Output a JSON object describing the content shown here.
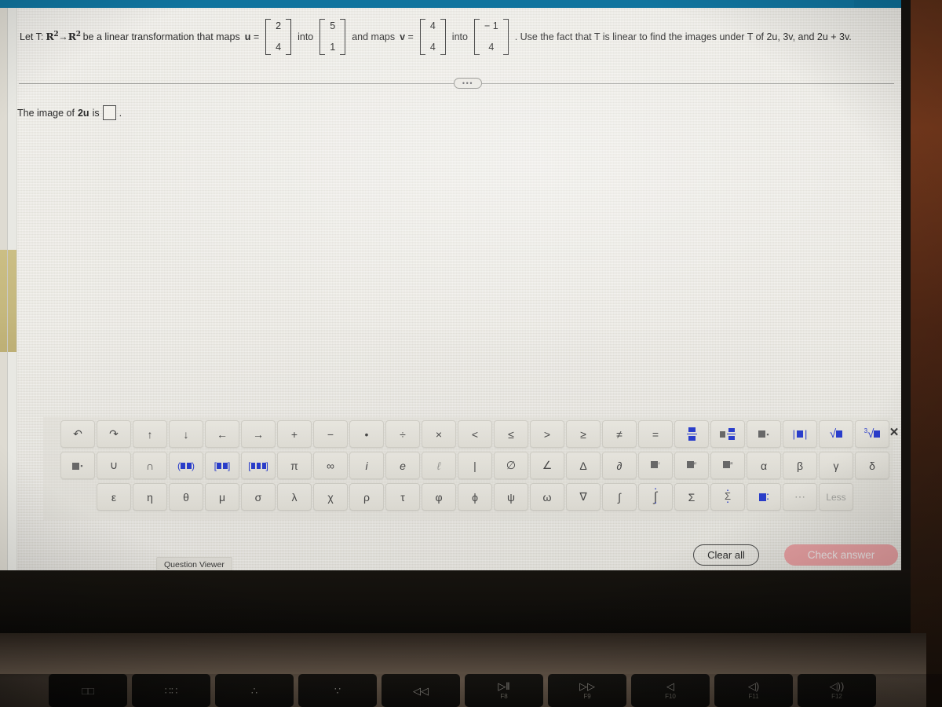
{
  "question": {
    "prefix": "Let T:",
    "domain_space": "R",
    "domain_exp": "2",
    "arrow": "→",
    "codomain_space": "R",
    "codomain_exp": "2",
    "mid1": "be a linear transformation that maps",
    "u_label": "u =",
    "u_vector": [
      "2",
      "4"
    ],
    "into1": "into",
    "u_image_vector": [
      "5",
      "1"
    ],
    "mid2": "and maps",
    "v_label": "v =",
    "v_vector": [
      "4",
      "4"
    ],
    "into2": "into",
    "v_image_vector": [
      "− 1",
      "4"
    ],
    "suffix": ". Use the fact that T is linear to find the images under T of 2u, 3v, and 2u + 3v."
  },
  "divider": {
    "ellipsis": "•••"
  },
  "answer": {
    "prompt_before": "The image of",
    "prompt_bold": "2u",
    "prompt_after": "is",
    "input_value": "",
    "period": "."
  },
  "keypad": {
    "close_icon": "✕",
    "row1": [
      {
        "name": "undo-icon",
        "glyph": "↶"
      },
      {
        "name": "redo-icon",
        "glyph": "↷"
      },
      {
        "name": "arrow-up-icon",
        "glyph": "↑"
      },
      {
        "name": "arrow-down-icon",
        "glyph": "↓"
      },
      {
        "name": "arrow-left-icon",
        "glyph": "←"
      },
      {
        "name": "arrow-right-icon",
        "glyph": "→"
      },
      {
        "name": "plus-key",
        "glyph": "+"
      },
      {
        "name": "minus-key",
        "glyph": "−"
      },
      {
        "name": "dot-multiply-key",
        "glyph": "•"
      },
      {
        "name": "divide-key",
        "glyph": "÷"
      },
      {
        "name": "times-key",
        "glyph": "×"
      },
      {
        "name": "less-than-key",
        "glyph": "<"
      },
      {
        "name": "less-or-equal-key",
        "glyph": "≤"
      },
      {
        "name": "greater-than-key",
        "glyph": ">"
      },
      {
        "name": "greater-or-equal-key",
        "glyph": "≥"
      },
      {
        "name": "not-equal-key",
        "glyph": "≠"
      },
      {
        "name": "equals-key",
        "glyph": "="
      },
      {
        "name": "fraction-key",
        "glyph": "fraction"
      },
      {
        "name": "mixed-fraction-key",
        "glyph": "mixed"
      },
      {
        "name": "exponent-key",
        "glyph": "power"
      },
      {
        "name": "absolute-value-key",
        "glyph": "abs"
      },
      {
        "name": "square-root-key",
        "glyph": "sqrt"
      },
      {
        "name": "nth-root-key",
        "glyph": "nthroot"
      }
    ],
    "row2": [
      {
        "name": "subscript-key",
        "glyph": "subscript"
      },
      {
        "name": "union-key",
        "glyph": "∪"
      },
      {
        "name": "intersection-key",
        "glyph": "∩"
      },
      {
        "name": "parenthesis-interval-key",
        "glyph": "(■,■)"
      },
      {
        "name": "bracket-interval-key",
        "glyph": "[■:■]"
      },
      {
        "name": "matrix-key",
        "glyph": "[■■■]"
      },
      {
        "name": "pi-key",
        "glyph": "π"
      },
      {
        "name": "infinity-key",
        "glyph": "∞"
      },
      {
        "name": "imaginary-unit-key",
        "glyph": "i"
      },
      {
        "name": "euler-e-key",
        "glyph": "e"
      },
      {
        "name": "script-l-key",
        "glyph": "ℓ"
      },
      {
        "name": "vertical-bar-key",
        "glyph": "|"
      },
      {
        "name": "empty-set-key",
        "glyph": "∅"
      },
      {
        "name": "angle-key",
        "glyph": "∠"
      },
      {
        "name": "delta-key",
        "glyph": "Δ"
      },
      {
        "name": "partial-derivative-key",
        "glyph": "∂"
      },
      {
        "name": "prime-key",
        "glyph": "prime"
      },
      {
        "name": "double-prime-key",
        "glyph": "dprime"
      },
      {
        "name": "triple-prime-key",
        "glyph": "tprime"
      },
      {
        "name": "alpha-key",
        "glyph": "α"
      },
      {
        "name": "beta-key",
        "glyph": "β"
      },
      {
        "name": "gamma-key",
        "glyph": "γ"
      },
      {
        "name": "delta-lower-key",
        "glyph": "δ"
      }
    ],
    "row3": [
      {
        "name": "epsilon-key",
        "glyph": "ε"
      },
      {
        "name": "eta-key",
        "glyph": "η"
      },
      {
        "name": "theta-key",
        "glyph": "θ"
      },
      {
        "name": "mu-key",
        "glyph": "μ"
      },
      {
        "name": "sigma-key",
        "glyph": "σ"
      },
      {
        "name": "lambda-key",
        "glyph": "λ"
      },
      {
        "name": "chi-key",
        "glyph": "χ"
      },
      {
        "name": "rho-key",
        "glyph": "ρ"
      },
      {
        "name": "tau-key",
        "glyph": "τ"
      },
      {
        "name": "varphi-key",
        "glyph": "φ"
      },
      {
        "name": "phi-key",
        "glyph": "ϕ"
      },
      {
        "name": "psi-key",
        "glyph": "ψ"
      },
      {
        "name": "omega-key",
        "glyph": "ω"
      },
      {
        "name": "nabla-key",
        "glyph": "∇"
      },
      {
        "name": "integral-key",
        "glyph": "∫"
      },
      {
        "name": "definite-integral-key",
        "glyph": "defint"
      },
      {
        "name": "sigma-sum-key",
        "glyph": "Σ"
      },
      {
        "name": "sum-limits-key",
        "glyph": "sumlim"
      },
      {
        "name": "sub-superscript-key",
        "glyph": "subsup"
      },
      {
        "name": "more-symbols-key",
        "glyph": "⋯"
      },
      {
        "name": "less-toggle-key",
        "glyph": "Less"
      }
    ]
  },
  "footer": {
    "question_viewer": "Question Viewer",
    "clear_all": "Clear all",
    "check_answer": "Check answer"
  },
  "laptop_keyboard": [
    {
      "name": "mission-control-key",
      "glyph": "□□",
      "flabel": ""
    },
    {
      "name": "launchpad-key",
      "glyph": "∷∷",
      "flabel": ""
    },
    {
      "name": "keyboard-brightness-down-key",
      "glyph": "∴",
      "flabel": ""
    },
    {
      "name": "keyboard-brightness-up-key",
      "glyph": "∵",
      "flabel": ""
    },
    {
      "name": "rewind-key",
      "glyph": "◁◁",
      "flabel": ""
    },
    {
      "name": "play-pause-key",
      "glyph": "▷‖",
      "flabel": "F8"
    },
    {
      "name": "fast-forward-key",
      "glyph": "▷▷",
      "flabel": "F9"
    },
    {
      "name": "mute-key",
      "glyph": "◁",
      "flabel": "F10"
    },
    {
      "name": "volume-down-key",
      "glyph": "◁)",
      "flabel": "F11"
    },
    {
      "name": "volume-up-key",
      "glyph": "◁))",
      "flabel": "F12"
    }
  ],
  "colors": {
    "top_strip": "#10749e",
    "check_button": "#eda4a6",
    "keypad_blue": "#2b3fd0"
  }
}
